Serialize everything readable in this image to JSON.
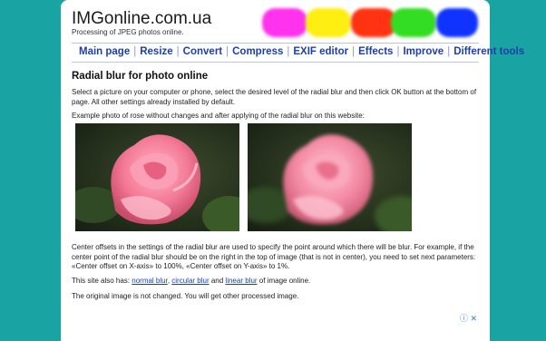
{
  "header": {
    "title": "IMGonline.com.ua",
    "subtitle": "Processing of JPEG photos online.",
    "blob_colors": [
      "#ff33ee",
      "#ffee11",
      "#ff3311",
      "#33dd22",
      "#1133ff"
    ]
  },
  "nav": {
    "items": [
      "Main page",
      "Resize",
      "Convert",
      "Compress",
      "EXIF editor",
      "Effects",
      "Improve",
      "Different tools"
    ],
    "separator": "|"
  },
  "content": {
    "heading": "Radial blur for photo online",
    "intro": "Select a picture on your computer or phone, select the desired level of the radial blur and then click OK button at the bottom of page. All other settings already installed by default.",
    "example_caption": "Example photo of rose without changes and after applying of the radial blur on this website:",
    "center_offsets": "Center offsets in the settings of the radial blur are used to specify the point around which there will be blur. For example, if the center point of the radial blur should be on the right in the top of image (that is not in center), you need to set next parameters: «Center offset on X-axis» to 100%, «Center offset on Y-axis» to 1%.",
    "also_prefix": "This site also has: ",
    "link_normal": "normal blur",
    "comma": ", ",
    "link_circular": "circular blur",
    "and_text": " and ",
    "link_linear": "linear blur",
    "also_suffix": " of image online.",
    "note": "The original image is not changed. You will get other processed image."
  },
  "ad": {
    "icons": "ⓘ ✕"
  }
}
